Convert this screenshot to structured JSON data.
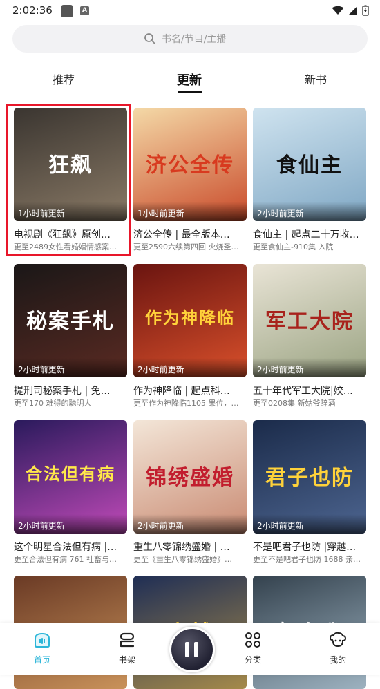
{
  "status": {
    "time": "2:02:36",
    "a_badge": "A"
  },
  "search": {
    "placeholder": "书名/节目/主播"
  },
  "tabs": [
    {
      "label": "推荐"
    },
    {
      "label": "更新"
    },
    {
      "label": "新书"
    }
  ],
  "cards": [
    {
      "title": "电视剧《狂飙》原创…",
      "sub": "更至2489女性看婚姻情感案…",
      "update": "1小时前更新",
      "cover_text": "狂飙",
      "colors": [
        "#3a3530",
        "#8a7a66"
      ],
      "text_color": "#fff"
    },
    {
      "title": "济公全传 | 最全版本…",
      "sub": "更至2590六续第四回 火烧圣…",
      "update": "1小时前更新",
      "cover_text": "济公全传",
      "colors": [
        "#f4d9a7",
        "#c94a2a"
      ],
      "text_color": "#d83a1f"
    },
    {
      "title": "食仙主 | 起点二十万收…",
      "sub": "更至食仙主-910集 入院",
      "update": "2小时前更新",
      "cover_text": "食仙主",
      "colors": [
        "#cfe3ef",
        "#7fa7c4"
      ],
      "text_color": "#111"
    },
    {
      "title": "提刑司秘案手札 | 免…",
      "sub": "更至170 难得的聪明人",
      "update": "2小时前更新",
      "cover_text": "秘案手札",
      "colors": [
        "#1a1717",
        "#5a2a22"
      ],
      "text_color": "#fff"
    },
    {
      "title": "作为神降临 | 起点科…",
      "sub": "更至作为神降临1105 果位，…",
      "update": "2小时前更新",
      "cover_text": "作为神降临",
      "colors": [
        "#6a1410",
        "#d9502b"
      ],
      "text_color": "#ffd23a"
    },
    {
      "title": "五十年代军工大院|姣…",
      "sub": "更至0208集 新姑爷辞酒",
      "update": "2小时前更新",
      "cover_text": "军工大院",
      "colors": [
        "#e9e4d6",
        "#9aa382"
      ],
      "text_color": "#a8221c"
    },
    {
      "title": "这个明星合法但有病 |…",
      "sub": "更至合法但有病 761 社畜与…",
      "update": "2小时前更新",
      "cover_text": "合法但有病",
      "colors": [
        "#2a1a5c",
        "#c04ab8"
      ],
      "text_color": "#ffe84a"
    },
    {
      "title": "重生八零锦绣盛婚 | …",
      "sub": "更至《重生八零锦绣盛婚》…",
      "update": "2小时前更新",
      "cover_text": "锦绣盛婚",
      "colors": [
        "#f3e6d8",
        "#c98a72"
      ],
      "text_color": "#c21e2e"
    },
    {
      "title": "不是吧君子也防 |穿越…",
      "sub": "更至不是吧君子也防 1688 亲…",
      "update": "2小时前更新",
      "cover_text": "君子也防",
      "colors": [
        "#1b2b4a",
        "#4d6590"
      ],
      "text_color": "#ffd23a"
    },
    {
      "title": "",
      "sub": "",
      "update": "",
      "cover_text": "",
      "colors": [
        "#6a3a25",
        "#c9925a"
      ],
      "text_color": "#fff"
    },
    {
      "title": "",
      "sub": "",
      "update": "",
      "cover_text": "穿越",
      "colors": [
        "#1f2e55",
        "#a58a4a"
      ],
      "text_color": "#ffd23a"
    },
    {
      "title": "",
      "sub": "",
      "update": "",
      "cover_text": "每次我",
      "colors": [
        "#34424e",
        "#9db2c0"
      ],
      "text_color": "#fff"
    }
  ],
  "bottom_nav": [
    {
      "label": "首页",
      "icon": "home-icon",
      "active": true
    },
    {
      "label": "书架",
      "icon": "bookshelf-icon",
      "active": false
    },
    {
      "label": "分类",
      "icon": "category-icon",
      "active": false
    },
    {
      "label": "我的",
      "icon": "profile-icon",
      "active": false
    }
  ],
  "accent_color": "#2cb6d9",
  "highlight_color": "#e8162a"
}
